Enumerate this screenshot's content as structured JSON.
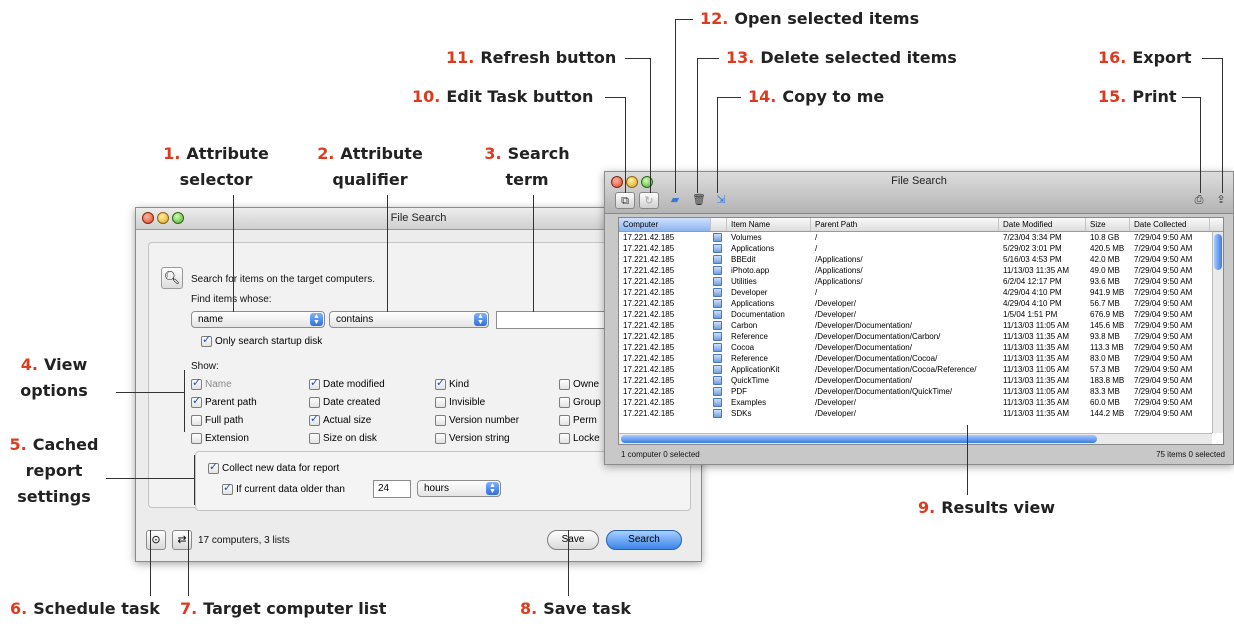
{
  "callouts": {
    "c1": {
      "num": "1.",
      "text": "Attribute",
      "text2": "selector"
    },
    "c2": {
      "num": "2.",
      "text": "Attribute",
      "text2": "qualifier"
    },
    "c3": {
      "num": "3.",
      "text": "Search",
      "text2": "term"
    },
    "c4": {
      "num": "4.",
      "text": "View",
      "text2": "options"
    },
    "c5": {
      "num": "5.",
      "text": "Cached",
      "text2": "report",
      "text3": "settings"
    },
    "c6": {
      "num": "6.",
      "text": "Schedule task"
    },
    "c7": {
      "num": "7.",
      "text": "Target computer list"
    },
    "c8": {
      "num": "8.",
      "text": "Save task"
    },
    "c9": {
      "num": "9.",
      "text": "Results view"
    },
    "c10": {
      "num": "10.",
      "text": "Edit Task button"
    },
    "c11": {
      "num": "11.",
      "text": "Refresh button"
    },
    "c12": {
      "num": "12.",
      "text": "Open selected items"
    },
    "c13": {
      "num": "13.",
      "text": "Delete selected items"
    },
    "c14": {
      "num": "14.",
      "text": "Copy to me"
    },
    "c15": {
      "num": "15.",
      "text": "Print"
    },
    "c16": {
      "num": "16.",
      "text": "Export"
    }
  },
  "search_window": {
    "title": "File Search",
    "instruction": "Search for items on the target computers.",
    "find_label": "Find items whose:",
    "attribute": "name",
    "qualifier": "contains",
    "term": "",
    "startup_only": "Only search startup disk",
    "show_label": "Show:",
    "view_options": [
      {
        "label": "Name",
        "checked": true,
        "dim": true
      },
      {
        "label": "Parent path",
        "checked": true
      },
      {
        "label": "Full path",
        "checked": false
      },
      {
        "label": "Extension",
        "checked": false
      },
      {
        "label": "Date modified",
        "checked": true
      },
      {
        "label": "Date created",
        "checked": false
      },
      {
        "label": "Actual size",
        "checked": true
      },
      {
        "label": "Size on disk",
        "checked": false
      },
      {
        "label": "Kind",
        "checked": true
      },
      {
        "label": "Invisible",
        "checked": false
      },
      {
        "label": "Version number",
        "checked": false
      },
      {
        "label": "Version string",
        "checked": false
      },
      {
        "label": "Owne",
        "checked": false
      },
      {
        "label": "Group",
        "checked": false
      },
      {
        "label": "Perm",
        "checked": false
      },
      {
        "label": "Locke",
        "checked": false
      }
    ],
    "collect_label": "Collect new data for report",
    "older_label": "If current data older than",
    "older_value": "24",
    "older_unit": "hours",
    "footer_status": "17 computers, 3 lists",
    "save_label": "Save",
    "search_label": "Search"
  },
  "results_window": {
    "title": "File Search",
    "columns": [
      "Computer",
      "",
      "Item Name",
      "Parent Path",
      "Date Modified",
      "Size",
      "Date Collected"
    ],
    "rows": [
      [
        "17.221.42.185",
        "Volumes",
        "/",
        "7/23/04 3:34 PM",
        "10.8 GB",
        "7/29/04 9:50 AM"
      ],
      [
        "17.221.42.185",
        "Applications",
        "/",
        "5/29/02 3:01 PM",
        "420.5 MB",
        "7/29/04 9:50 AM"
      ],
      [
        "17.221.42.185",
        "BBEdit",
        "/Applications/",
        "5/16/03 4:53 PM",
        "42.0 MB",
        "7/29/04 9:50 AM"
      ],
      [
        "17.221.42.185",
        "iPhoto.app",
        "/Applications/",
        "11/13/03 11:35 AM",
        "49.0 MB",
        "7/29/04 9:50 AM"
      ],
      [
        "17.221.42.185",
        "Utilities",
        "/Applications/",
        "6/2/04 12:17 PM",
        "93.6 MB",
        "7/29/04 9:50 AM"
      ],
      [
        "17.221.42.185",
        "Developer",
        "/",
        "4/29/04 4:10 PM",
        "941.9 MB",
        "7/29/04 9:50 AM"
      ],
      [
        "17.221.42.185",
        "Applications",
        "/Developer/",
        "4/29/04 4:10 PM",
        "56.7 MB",
        "7/29/04 9:50 AM"
      ],
      [
        "17.221.42.185",
        "Documentation",
        "/Developer/",
        "1/5/04 1:51 PM",
        "676.9 MB",
        "7/29/04 9:50 AM"
      ],
      [
        "17.221.42.185",
        "Carbon",
        "/Developer/Documentation/",
        "11/13/03 11:05 AM",
        "145.6 MB",
        "7/29/04 9:50 AM"
      ],
      [
        "17.221.42.185",
        "Reference",
        "/Developer/Documentation/Carbon/",
        "11/13/03 11:35 AM",
        "93.8 MB",
        "7/29/04 9:50 AM"
      ],
      [
        "17.221.42.185",
        "Cocoa",
        "/Developer/Documentation/",
        "11/13/03 11:35 AM",
        "113.3 MB",
        "7/29/04 9:50 AM"
      ],
      [
        "17.221.42.185",
        "Reference",
        "/Developer/Documentation/Cocoa/",
        "11/13/03 11:35 AM",
        "83.0 MB",
        "7/29/04 9:50 AM"
      ],
      [
        "17.221.42.185",
        "ApplicationKit",
        "/Developer/Documentation/Cocoa/Reference/",
        "11/13/03 11:05 AM",
        "57.3 MB",
        "7/29/04 9:50 AM"
      ],
      [
        "17.221.42.185",
        "QuickTime",
        "/Developer/Documentation/",
        "11/13/03 11:35 AM",
        "183.8 MB",
        "7/29/04 9:50 AM"
      ],
      [
        "17.221.42.185",
        "PDF",
        "/Developer/Documentation/QuickTime/",
        "11/13/03 11:05 AM",
        "83.3 MB",
        "7/29/04 9:50 AM"
      ],
      [
        "17.221.42.185",
        "Examples",
        "/Developer/",
        "11/13/03 11:35 AM",
        "60.0 MB",
        "7/29/04 9:50 AM"
      ],
      [
        "17.221.42.185",
        "SDKs",
        "/Developer/",
        "11/13/03 11:35 AM",
        "144.2 MB",
        "7/29/04 9:50 AM"
      ]
    ],
    "status_left": "1 computer   0 selected",
    "status_right": "75 items   0 selected"
  }
}
